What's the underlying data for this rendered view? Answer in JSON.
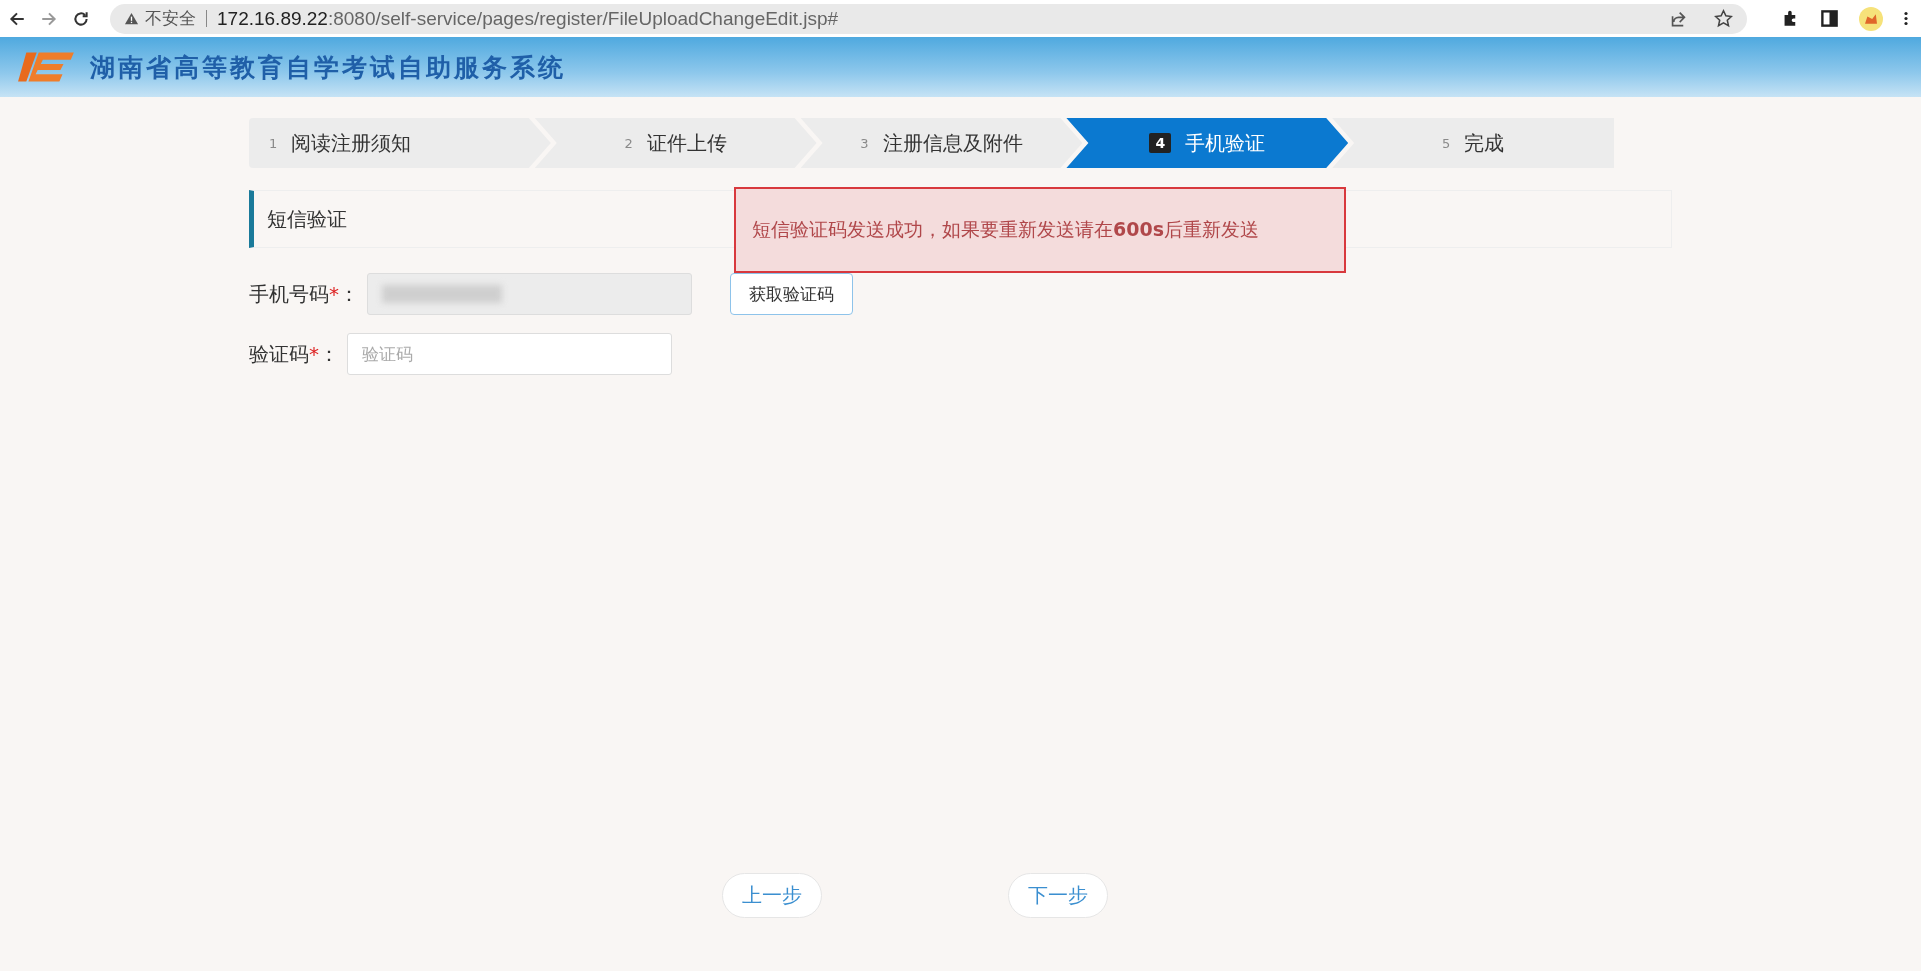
{
  "browser": {
    "security_label": "不安全",
    "url_host": "172.16.89.22",
    "url_rest": ":8080/self-service/pages/register/FileUploadChangeEdit.jsp#"
  },
  "header": {
    "title": "湖南省高等教育自学考试自助服务系统"
  },
  "steps": [
    {
      "number": "1",
      "label": "阅读注册须知",
      "selected": false
    },
    {
      "number": "2",
      "label": "证件上传",
      "selected": false
    },
    {
      "number": "3",
      "label": "注册信息及附件",
      "selected": false
    },
    {
      "number": "4",
      "label": "手机验证",
      "selected": true
    },
    {
      "number": "5",
      "label": "完成",
      "selected": false
    }
  ],
  "section": {
    "title": "短信验证"
  },
  "toast": {
    "message": "短信验证码发送成功，如果要重新发送请在**600s**后重新发送"
  },
  "form": {
    "fields": [
      {
        "label": "手机号码",
        "required": "*",
        "colon": "：",
        "kind": "blurred",
        "button": "获取验证码"
      },
      {
        "label": "验证码",
        "required": "*",
        "colon": "：",
        "kind": "input",
        "placeholder": "验证码"
      }
    ]
  },
  "footer": {
    "buttons": [
      "上一步",
      "下一步"
    ]
  }
}
